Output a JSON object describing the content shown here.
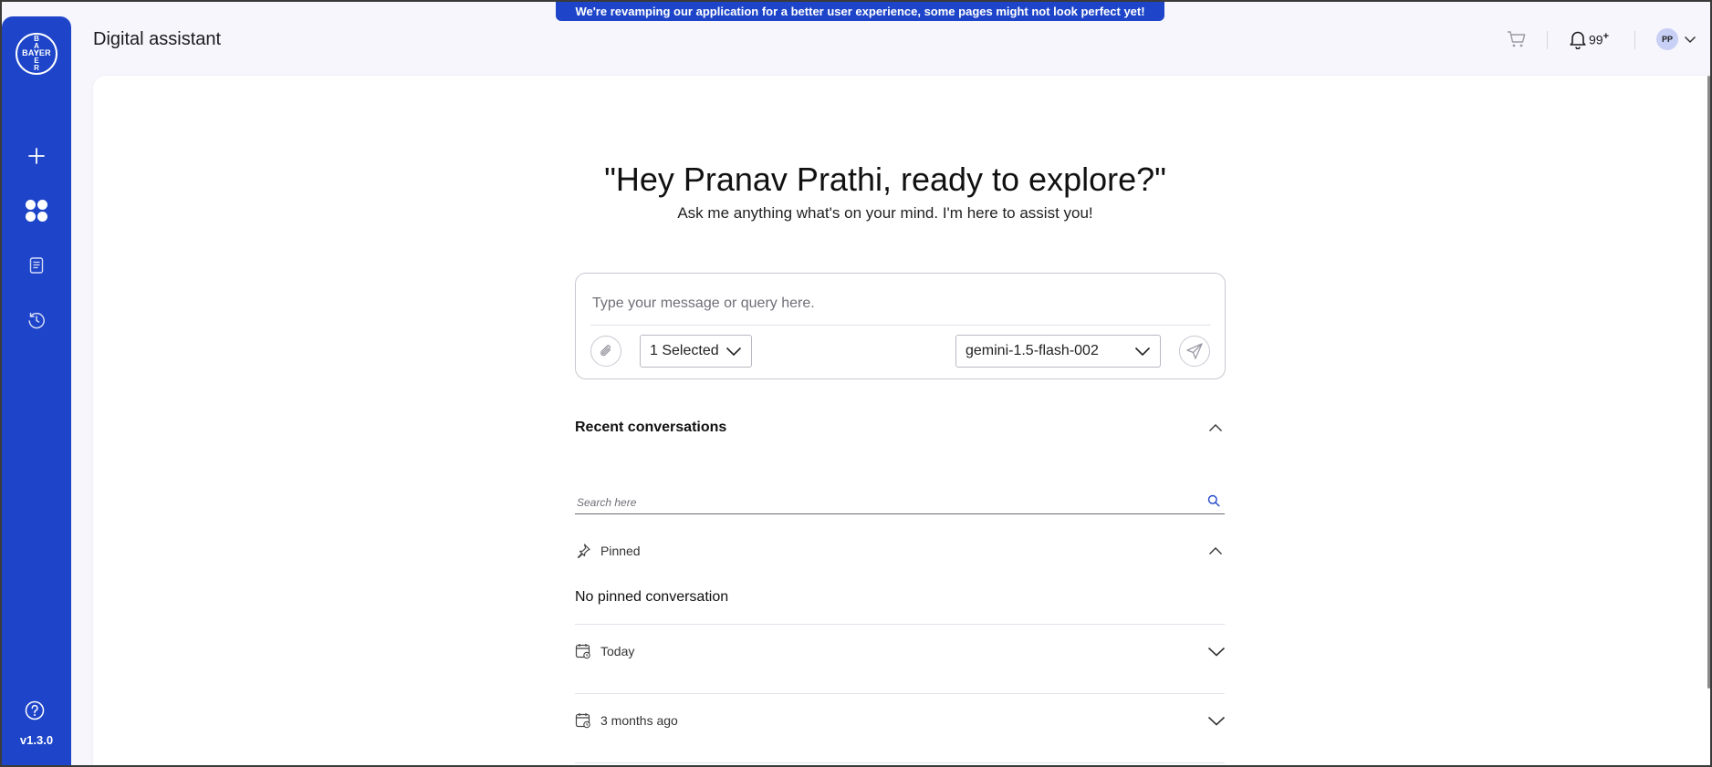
{
  "banner": {
    "text": "We're revamping our application for a better user experience, some pages might not look perfect yet!"
  },
  "sidebar": {
    "logo": {
      "horizontal": "BAYER",
      "vertical": "B\nA\nY\nE\nR"
    },
    "items": [
      {
        "icon": "plus-icon",
        "label": "New chat"
      },
      {
        "icon": "apps-icon",
        "label": "Apps"
      },
      {
        "icon": "document-icon",
        "label": "Documents"
      },
      {
        "icon": "history-icon",
        "label": "History"
      }
    ],
    "help_icon": "help-icon",
    "version": "v1.3.0"
  },
  "header": {
    "title": "Digital assistant",
    "notifications": {
      "count": "99",
      "plus": "+"
    },
    "user": {
      "initials": "PP"
    }
  },
  "hero": {
    "greeting": "\"Hey Pranav Prathi, ready to explore?\"",
    "subtitle": "Ask me anything what's on your mind. I'm here to assist you!"
  },
  "composer": {
    "placeholder": "Type your message or query here.",
    "selection_label": "1 Selected",
    "model": "gemini-1.5-flash-002"
  },
  "recent": {
    "title": "Recent conversations",
    "search_placeholder": "Search here",
    "pinned": {
      "label": "Pinned",
      "empty_text": "No pinned conversation"
    },
    "groups": [
      {
        "label": "Today"
      },
      {
        "label": "3 months ago"
      }
    ]
  },
  "colors": {
    "accent": "#1e45c9",
    "background": "#f7f6fc"
  }
}
